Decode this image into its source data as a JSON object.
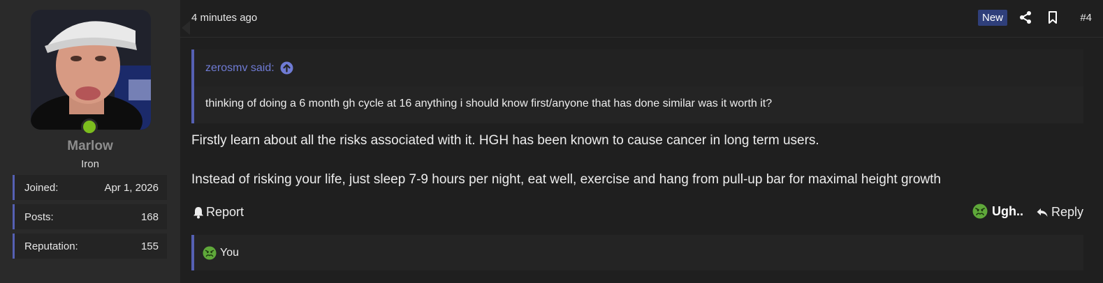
{
  "user": {
    "name": "Marlow",
    "title": "Iron",
    "online": true,
    "stats": [
      {
        "label": "Joined:",
        "value": "Apr 1, 2026"
      },
      {
        "label": "Posts:",
        "value": "168"
      },
      {
        "label": "Reputation:",
        "value": "155"
      }
    ]
  },
  "post": {
    "time": "4 minutes ago",
    "badge": "New",
    "number": "#4",
    "quote": {
      "author_said": "zerosmv said:",
      "text": "thinking of doing a 6 month gh cycle at 16 anything i should know first/anyone that has done similar was it worth it?"
    },
    "body": [
      "Firstly learn about all the risks associated with it. HGH has been known to cause cancer in long term users.",
      "Instead of risking your life, just sleep 7-9 hours per night, eat well, exercise and hang from pull-up bar for maximal height growth"
    ],
    "actions": {
      "report": "Report",
      "reaction": "Ugh..",
      "reply": "Reply"
    },
    "reactions_summary": "You"
  },
  "colors": {
    "accent": "#5560b3",
    "link": "#6f7bd4",
    "online": "#7cbd1e",
    "badge_bg": "#2f3f7a",
    "reaction_green": "#5fa83a"
  },
  "icons": [
    "goto-arrow-icon",
    "share-icon",
    "bookmark-icon",
    "bell-icon",
    "nauseated-emoji-icon",
    "reply-arrow-icon"
  ]
}
